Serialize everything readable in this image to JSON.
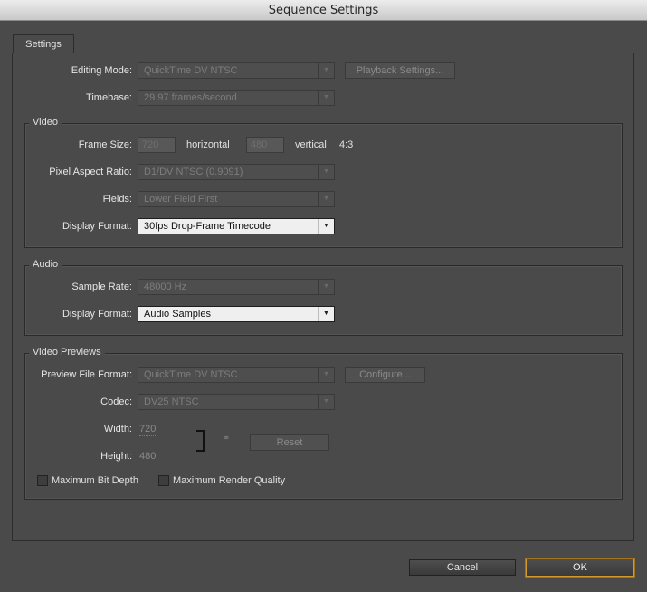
{
  "window": {
    "title": "Sequence Settings"
  },
  "tab": {
    "label": "Settings"
  },
  "general": {
    "editing_mode_label": "Editing Mode:",
    "editing_mode_value": "QuickTime DV NTSC",
    "playback_settings_label": "Playback Settings...",
    "timebase_label": "Timebase:",
    "timebase_value": "29.97 frames/second"
  },
  "video": {
    "group_title": "Video",
    "frame_size_label": "Frame Size:",
    "frame_width": "720",
    "horizontal_label": "horizontal",
    "frame_height": "480",
    "vertical_label": "vertical",
    "aspect_ratio": "4:3",
    "pixel_aspect_label": "Pixel Aspect Ratio:",
    "pixel_aspect_value": "D1/DV NTSC (0.9091)",
    "fields_label": "Fields:",
    "fields_value": "Lower Field First",
    "display_format_label": "Display Format:",
    "display_format_value": "30fps Drop-Frame Timecode"
  },
  "audio": {
    "group_title": "Audio",
    "sample_rate_label": "Sample Rate:",
    "sample_rate_value": "48000 Hz",
    "display_format_label": "Display Format:",
    "display_format_value": "Audio Samples"
  },
  "previews": {
    "group_title": "Video Previews",
    "file_format_label": "Preview File Format:",
    "file_format_value": "QuickTime DV NTSC",
    "configure_label": "Configure...",
    "codec_label": "Codec:",
    "codec_value": "DV25 NTSC",
    "width_label": "Width:",
    "width_value": "720",
    "height_label": "Height:",
    "height_value": "480",
    "reset_label": "Reset",
    "max_bit_depth_label": "Maximum Bit Depth",
    "max_render_quality_label": "Maximum Render Quality"
  },
  "footer": {
    "cancel_label": "Cancel",
    "ok_label": "OK"
  }
}
